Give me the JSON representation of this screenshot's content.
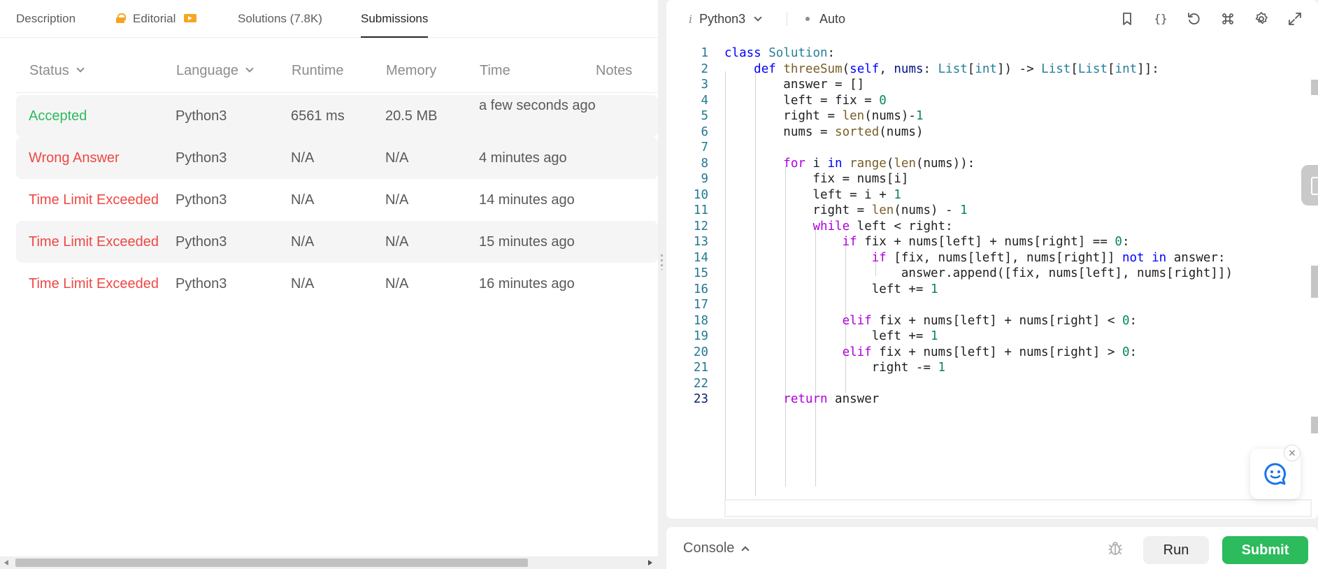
{
  "tabs": {
    "description": "Description",
    "editorial": "Editorial",
    "solutions": "Solutions (7.8K)",
    "submissions": "Submissions"
  },
  "table": {
    "headers": [
      "Status",
      "Language",
      "Runtime",
      "Memory",
      "Time",
      "Notes"
    ],
    "rows": [
      {
        "status": "Accepted",
        "language": "Python3",
        "runtime": "6561 ms",
        "memory": "20.5 MB",
        "time": "a few seconds ago"
      },
      {
        "status": "Wrong Answer",
        "language": "Python3",
        "runtime": "N/A",
        "memory": "N/A",
        "time": "4 minutes ago"
      },
      {
        "status": "Time Limit Exceeded",
        "language": "Python3",
        "runtime": "N/A",
        "memory": "N/A",
        "time": "14 minutes ago"
      },
      {
        "status": "Time Limit Exceeded",
        "language": "Python3",
        "runtime": "N/A",
        "memory": "N/A",
        "time": "15 minutes ago"
      },
      {
        "status": "Time Limit Exceeded",
        "language": "Python3",
        "runtime": "N/A",
        "memory": "N/A",
        "time": "16 minutes ago"
      }
    ]
  },
  "editor": {
    "language_icon": "i",
    "language": "Python3",
    "mode": "Auto",
    "toolbar_icons": [
      "bookmark-icon",
      "braces-icon",
      "reset-icon",
      "command-icon",
      "gear-icon",
      "expand-icon"
    ],
    "code_lines": [
      "class Solution:",
      "    def threeSum(self, nums: List[int]) -> List[List[int]]:",
      "        answer = []",
      "        left = fix = 0",
      "        right = len(nums)-1",
      "        nums = sorted(nums)",
      "",
      "        for i in range(len(nums)):",
      "            fix = nums[i]",
      "            left = i + 1",
      "            right = len(nums) - 1",
      "            while left < right:",
      "                if fix + nums[left] + nums[right] == 0:",
      "                    if [fix, nums[left], nums[right]] not in answer:",
      "                        answer.append([fix, nums[left], nums[right]])",
      "                    left += 1",
      "",
      "                elif fix + nums[left] + nums[right] < 0:",
      "                    left += 1",
      "                elif fix + nums[left] + nums[right] > 0:",
      "                    right -= 1",
      "",
      "        return answer"
    ]
  },
  "console": {
    "label": "Console",
    "run": "Run",
    "submit": "Submit"
  },
  "colors": {
    "accepted": "#2cbb5d",
    "error": "#ef4743",
    "submit_bg": "#2cbb5d",
    "keyword": "#0000ff",
    "control": "#af00db",
    "class": "#267f99",
    "function": "#795e26",
    "number": "#098658",
    "line_number": "#237893"
  }
}
